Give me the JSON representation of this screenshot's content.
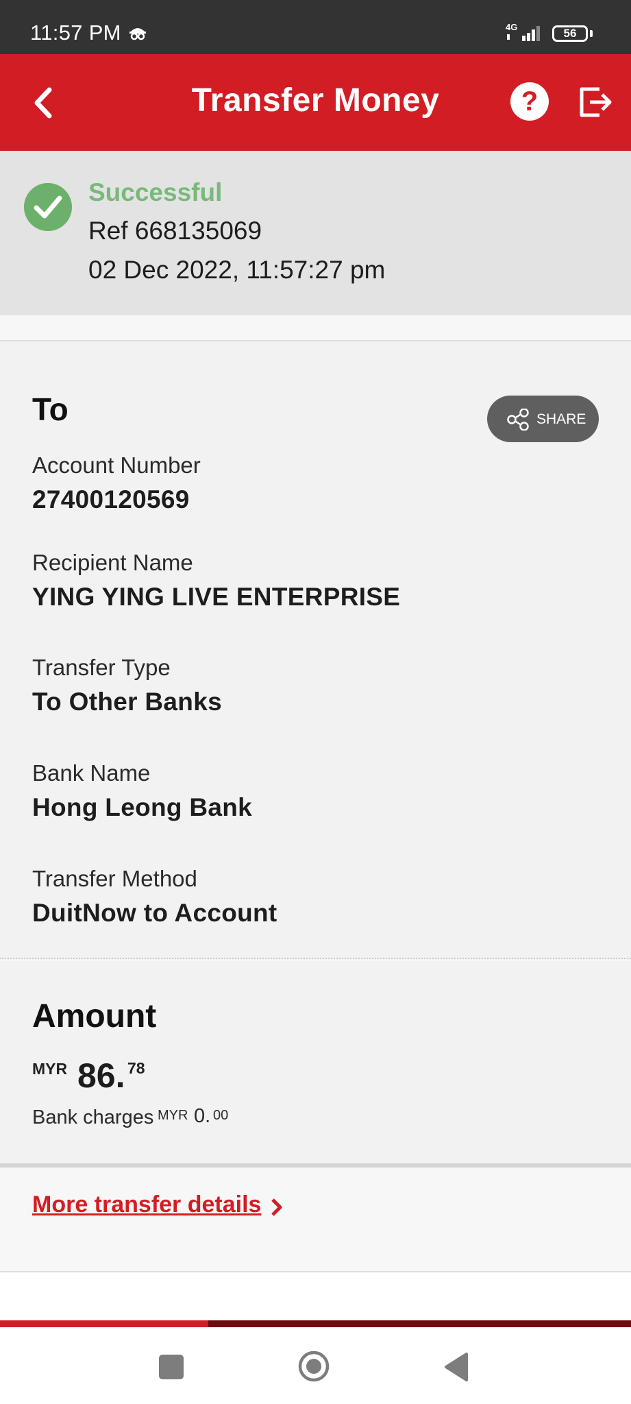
{
  "status_bar": {
    "time": "11:57 PM",
    "network": "4G",
    "battery": "56"
  },
  "app_bar": {
    "title": "Transfer Money",
    "help_glyph": "?"
  },
  "result": {
    "status": "Successful",
    "ref": "Ref 668135069",
    "datetime": "02 Dec 2022, 11:57:27 pm"
  },
  "details": {
    "heading": "To",
    "share_label": "SHARE",
    "fields": [
      {
        "label": "Account Number",
        "value": "27400120569"
      },
      {
        "label": "Recipient Name",
        "value": "YING YING LIVE ENTERPRISE"
      },
      {
        "label": "Transfer Type",
        "value": "To Other Banks"
      },
      {
        "label": "Bank Name",
        "value": "Hong Leong Bank"
      },
      {
        "label": "Transfer Method",
        "value": "DuitNow to Account"
      }
    ]
  },
  "amount": {
    "heading": "Amount",
    "currency": "MYR",
    "whole": "86.",
    "cents": "78",
    "charges_label": "Bank charges",
    "charges_currency": "MYR",
    "charges_whole": "0.",
    "charges_cents": "00"
  },
  "more": {
    "link_label": "More transfer details"
  },
  "progress": {
    "fraction": 0.33
  },
  "colors": {
    "brand_red": "#d31d25",
    "success_green": "#79b97a"
  },
  "icons": [
    "back-arrow-icon",
    "help-icon",
    "logout-icon",
    "check-circle-icon",
    "share-icon",
    "chevron-right-icon",
    "nav-recents-icon",
    "nav-home-icon",
    "nav-back-icon"
  ]
}
